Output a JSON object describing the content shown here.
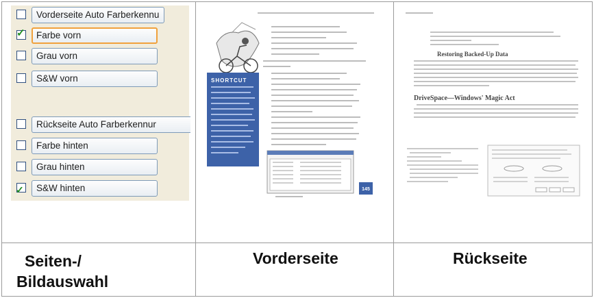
{
  "options": [
    {
      "label": "Vorderseite Auto Farberkennu",
      "checked": false,
      "selected": false
    },
    {
      "label": "Farbe vorn",
      "checked": true,
      "selected": true
    },
    {
      "label": "Grau vorn",
      "checked": false,
      "selected": false
    },
    {
      "label": "S&W vorn",
      "checked": false,
      "selected": false
    },
    {
      "label": "Rückseite Auto Farberkennur",
      "checked": false,
      "selected": false
    },
    {
      "label": "Farbe hinten",
      "checked": false,
      "selected": false
    },
    {
      "label": "Grau hinten",
      "checked": false,
      "selected": false
    },
    {
      "label": "S&W hinten",
      "checked": false,
      "selected": false
    }
  ],
  "front_page": {
    "shortcut_label": "SHORTCUT",
    "page_number": "145"
  },
  "back_page": {
    "heading1": "Restoring Backed-Up Data",
    "heading2": "DriveSpace—Windows' Magic Act"
  },
  "captions": {
    "left_line1": "Seiten-/",
    "left_line2": "Bildauswahl",
    "middle": "Vorderseite",
    "right": "Rückseite"
  },
  "colors": {
    "selection_orange": "#f0a13c",
    "checkmark_green": "#1e8c1e",
    "shortcut_blue": "#3d62a8",
    "panel_bg": "#f1ecdc"
  }
}
